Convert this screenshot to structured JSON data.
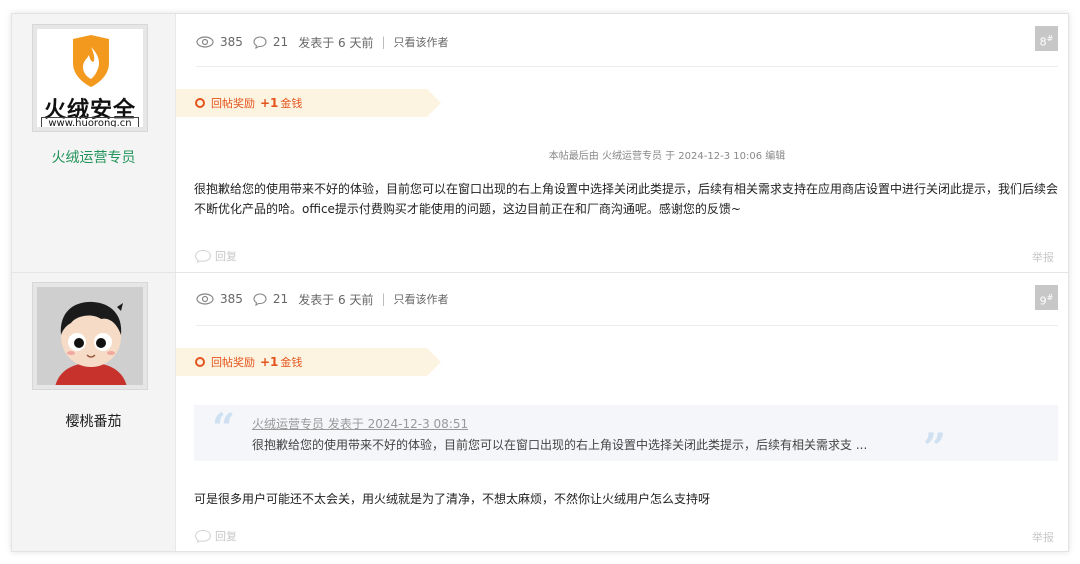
{
  "posts": [
    {
      "author": {
        "name": "火绒运营专员",
        "avatar_brand": "火绒安全",
        "avatar_url_text": "www.huorong.cn"
      },
      "views": "385",
      "comments": "21",
      "posted": "发表于 6 天前",
      "only_author": "只看该作者",
      "floor": "8",
      "floor_sup": "#",
      "reward": {
        "label": "回帖奖励",
        "plus": "+1",
        "unit": "金钱"
      },
      "edit_note": "本帖最后由 火绒运营专员 于 2024-12-3 10:06 编辑",
      "body": "很抱歉给您的使用带来不好的体验，目前您可以在窗口出现的右上角设置中选择关闭此类提示，后续有相关需求支持在应用商店设置中进行关闭此提示，我们后续会不断优化产品的哈。office提示付费购买才能使用的问题，这边目前正在和厂商沟通呢。感谢您的反馈~",
      "reply_label": "回复",
      "report_label": "举报"
    },
    {
      "author": {
        "name": "樱桃番茄"
      },
      "views": "385",
      "comments": "21",
      "posted": "发表于 6 天前",
      "only_author": "只看该作者",
      "floor": "9",
      "floor_sup": "#",
      "reward": {
        "label": "回帖奖励",
        "plus": "+1",
        "unit": "金钱"
      },
      "quote": {
        "open_mark": "“",
        "close_mark": "”",
        "header": "火绒运营专员 发表于 2024-12-3 08:51",
        "text": "很抱歉给您的使用带来不好的体验，目前您可以在窗口出现的右上角设置中选择关闭此类提示，后续有相关需求支 ..."
      },
      "body": "可是很多用户可能还不太会关，用火绒就是为了清净，不想太麻烦，不然你让火绒用户怎么支持呀",
      "reply_label": "回复",
      "report_label": "举报"
    }
  ],
  "icons": {
    "views": "eye-icon",
    "comments": "speech-bubble-icon",
    "reply": "reply-bubble-icon",
    "reward": "reward-circle-icon"
  },
  "colors": {
    "accent_orange": "#e4551d",
    "author_green": "#21935a",
    "floor_badge": "#c7c7c7"
  }
}
